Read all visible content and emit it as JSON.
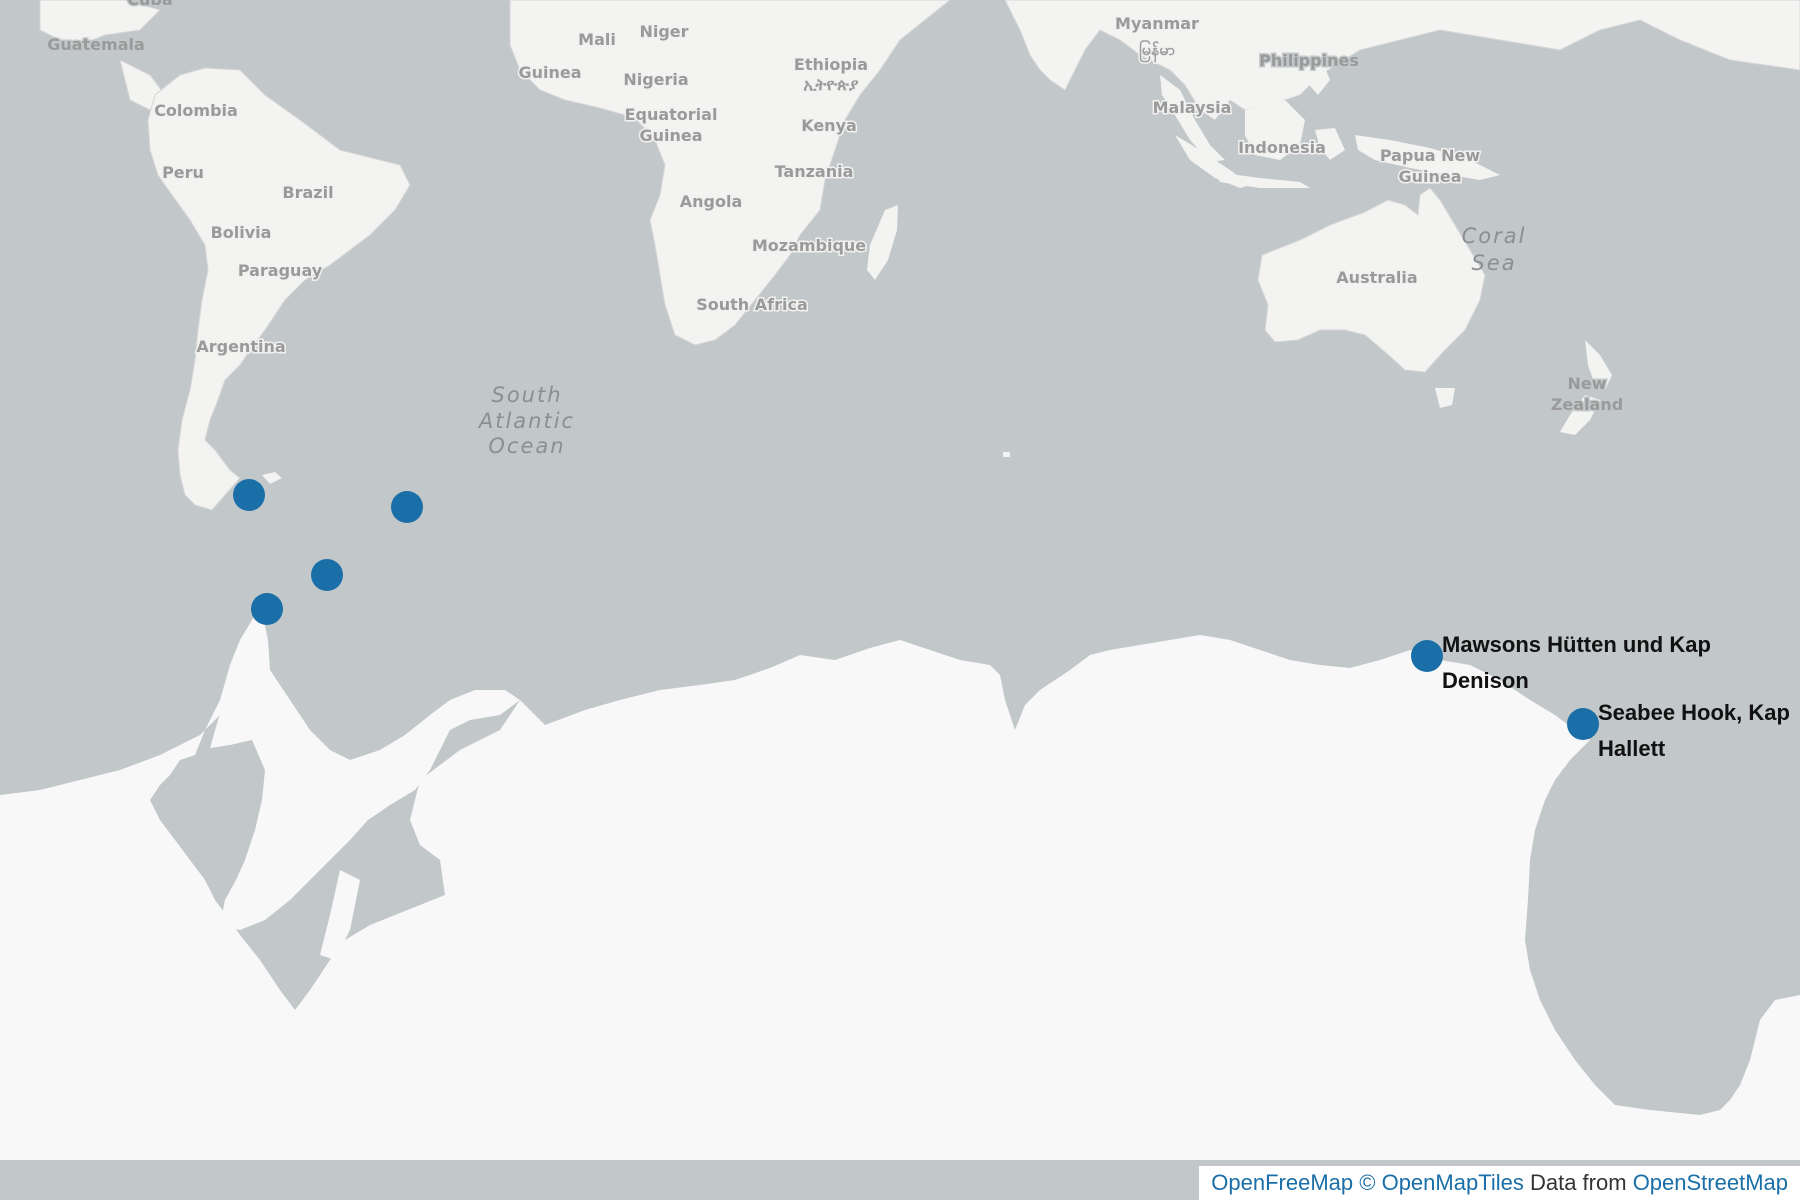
{
  "map": {
    "ocean_labels": {
      "south_atlantic": [
        "South",
        "Atlantic",
        "Ocean"
      ],
      "coral_sea": [
        "Coral",
        "Sea"
      ]
    },
    "country_labels": {
      "cuba": "Cuba",
      "guatemala": "Guatemala",
      "colombia": "Colombia",
      "peru": "Peru",
      "brazil": "Brazil",
      "bolivia": "Bolivia",
      "paraguay": "Paraguay",
      "argentina": "Argentina",
      "mali": "Mali",
      "niger": "Niger",
      "guinea": "Guinea",
      "nigeria": "Nigeria",
      "ethiopia": "Ethiopia",
      "ethiopia_native": "ኢትዮጵያ",
      "equatorial_guinea": [
        "Equatorial",
        "Guinea"
      ],
      "kenya": "Kenya",
      "tanzania": "Tanzania",
      "angola": "Angola",
      "mozambique": "Mozambique",
      "south_africa": "South Africa",
      "myanmar": "Myanmar",
      "myanmar_native": "မြန်မာ",
      "philippines": "Philippines",
      "malaysia": "Malaysia",
      "indonesia": "Indonesia",
      "papua_new_guinea": [
        "Papua New",
        "Guinea"
      ],
      "australia": "Australia",
      "new_zealand": [
        "New",
        "Zealand"
      ]
    },
    "marker_color": "#1a6fa8",
    "land_color": "#f3f3f2",
    "ice_color": "#f8f8f8",
    "water_color": "#c2c7c9",
    "markers": [
      {
        "name": "unlabeled-marker-1",
        "label": []
      },
      {
        "name": "unlabeled-marker-2",
        "label": []
      },
      {
        "name": "unlabeled-marker-3",
        "label": []
      },
      {
        "name": "unlabeled-marker-4",
        "label": []
      },
      {
        "name": "mawsons-huetten",
        "label": [
          "Mawsons Hütten und Kap",
          "Denison"
        ]
      },
      {
        "name": "seabee-hook",
        "label": [
          "Seabee Hook, Kap",
          "Hallett"
        ]
      }
    ]
  },
  "attribution": {
    "openfreemap": "OpenFreeMap",
    "copyright": "© OpenMapTiles",
    "data_from": "Data from",
    "openstreetmap": "OpenStreetMap"
  }
}
